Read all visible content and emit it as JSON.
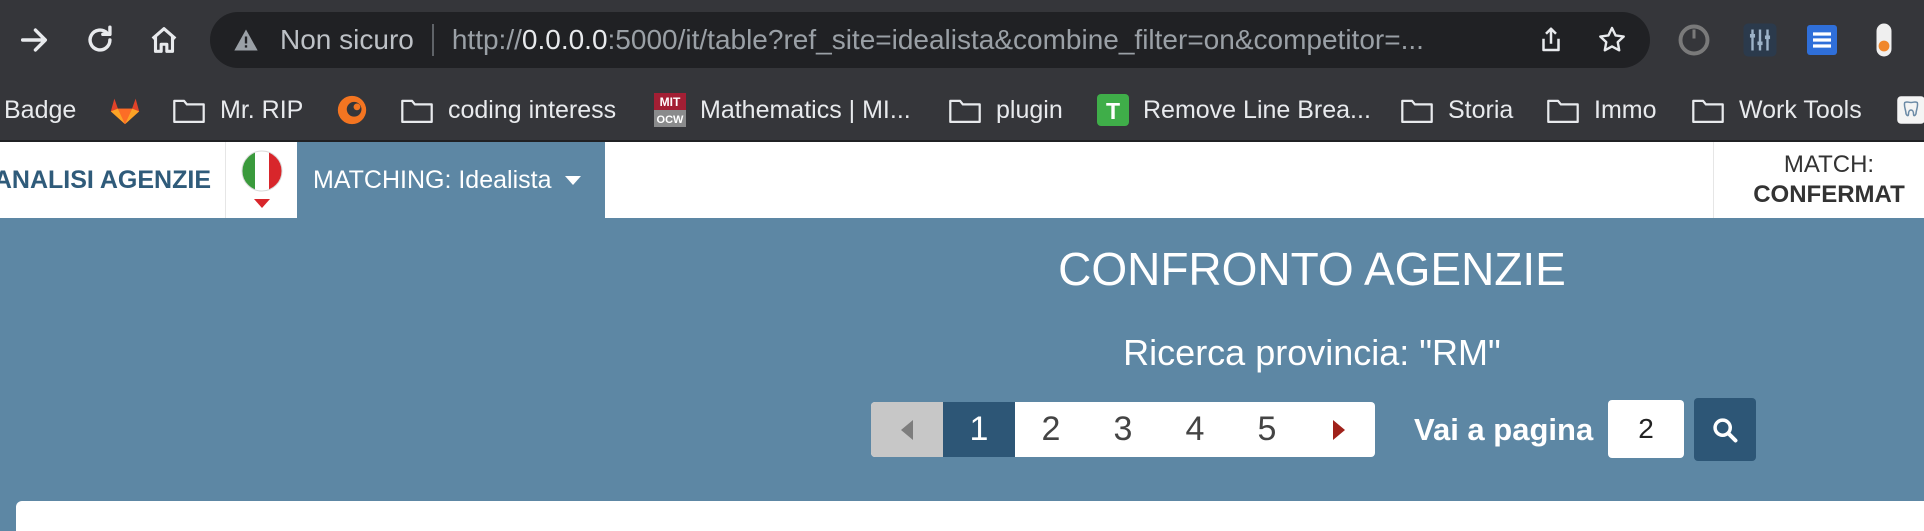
{
  "browser": {
    "url_security": "Non sicuro",
    "url_scheme": "http://",
    "url_host": "0.0.0.0",
    "url_rest": ":5000/it/table?ref_site=idealista&combine_filter=on&competitor=..."
  },
  "bookmarks": [
    {
      "label": "Badge",
      "icon": "none"
    },
    {
      "label": "",
      "icon": "gitlab-icon"
    },
    {
      "label": "Mr. RIP",
      "icon": "folder-icon"
    },
    {
      "label": "",
      "icon": "crunchyroll-icon"
    },
    {
      "label": "coding interess",
      "icon": "folder-icon"
    },
    {
      "label": "Mathematics | MI...",
      "icon": "mit-ocw-icon"
    },
    {
      "label": "plugin",
      "icon": "folder-icon"
    },
    {
      "label": "Remove Line Brea...",
      "icon": "t-icon"
    },
    {
      "label": "Storia",
      "icon": "folder-icon"
    },
    {
      "label": "Immo",
      "icon": "folder-icon"
    },
    {
      "label": "Work Tools",
      "icon": "folder-icon"
    }
  ],
  "mit_icon": {
    "top": "MIT",
    "bottom": "OCW"
  },
  "t_icon": {
    "letter": "T"
  },
  "nav": {
    "brand": "ANALISI AGENZIE",
    "matching": "MATCHING: Idealista",
    "match_label": "MATCH:",
    "match_value": "CONFERMAT"
  },
  "main": {
    "title": "CONFRONTO AGENZIE",
    "subtitle": "Ricerca provincia: \"RM\"",
    "pages": [
      "1",
      "2",
      "3",
      "4",
      "5"
    ],
    "active_page": "1",
    "goto_label": "Vai a pagina",
    "goto_value": "2"
  },
  "colors": {
    "toolbar": "#35363a",
    "omnibox": "#202124",
    "brand_blue": "#2f5b7a",
    "main_bg": "#5d87a4",
    "active_page": "#2d5676",
    "next_arrow": "#a0221b"
  }
}
